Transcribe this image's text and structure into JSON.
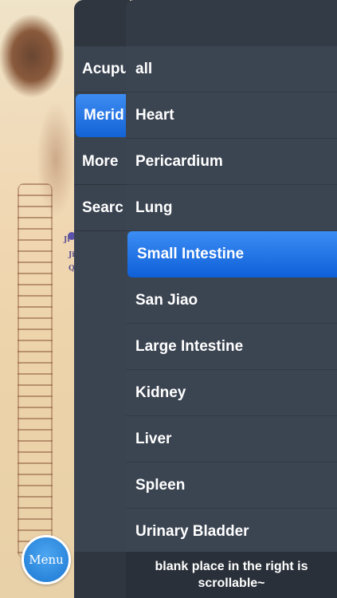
{
  "background_labels": [
    "Ji",
    "Ji",
    "Q"
  ],
  "left_nav": {
    "items": [
      {
        "label": "Acupu",
        "active": false
      },
      {
        "label": "Merid",
        "active": true
      },
      {
        "label": "More",
        "active": false
      },
      {
        "label": "Searc",
        "active": false
      }
    ]
  },
  "meridian_menu": {
    "items": [
      {
        "label": "all",
        "active": false
      },
      {
        "label": "Heart",
        "active": false
      },
      {
        "label": "Pericardium",
        "active": false
      },
      {
        "label": "Lung",
        "active": false
      },
      {
        "label": "Small Intestine",
        "active": true
      },
      {
        "label": "San Jiao",
        "active": false
      },
      {
        "label": "Large Intestine",
        "active": false
      },
      {
        "label": "Kidney",
        "active": false
      },
      {
        "label": "Liver",
        "active": false
      },
      {
        "label": "Spleen",
        "active": false
      },
      {
        "label": "Urinary Bladder",
        "active": false
      }
    ],
    "footer_hint": "blank place in the right is scrollable~"
  },
  "menu_button": {
    "label": "Menu"
  },
  "colors": {
    "accent": "#1a6fe0",
    "panel": "#3b4451",
    "panel_dark": "#2f3640"
  }
}
